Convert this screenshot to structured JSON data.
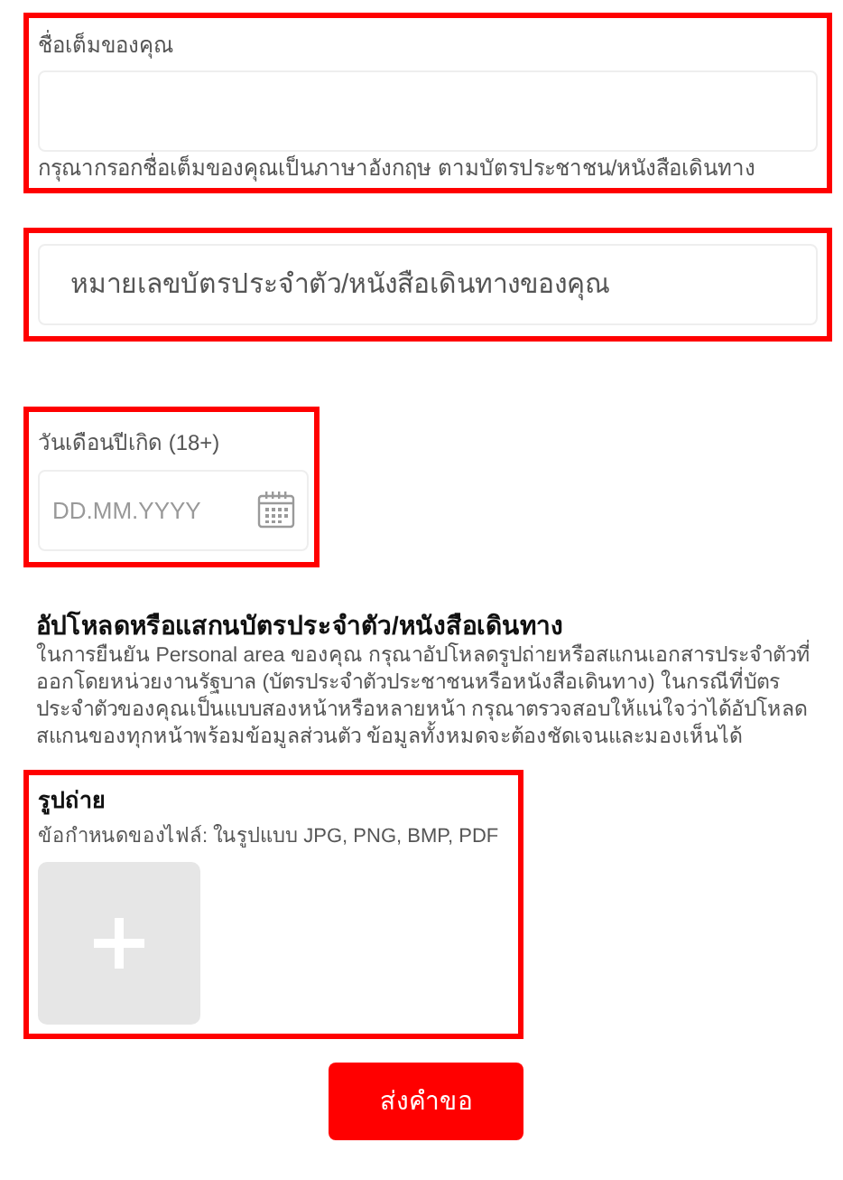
{
  "fields": [
    {
      "kind": "text",
      "label": "ชื่อเต็มของคุณ",
      "hint": "กรุณากรอกชื่อเต็มของคุณเป็นภาษาอังกฤษ ตามบัตรประชาชน/หนังสือเดินทาง"
    },
    {
      "kind": "text",
      "placeholder": "หมายเลขบัตรประจำตัว/หนังสือเดินทางของคุณ"
    },
    {
      "kind": "date",
      "label": "วันเดือนปีเกิด (18+)",
      "placeholder": "DD.MM.YYYY"
    }
  ],
  "upload_section": {
    "title": "อัปโหลดหรือแสกนบัตรประจำตัว/หนังสือเดินทาง",
    "description": "ในการยืนยัน Personal area ของคุณ กรุณาอัปโหลดรูปถ่ายหรือสแกนเอกสารประจำตัวที่ออกโดยหน่วยงานรัฐบาล (บัตรประจำตัวประชาชนหรือหนังสือเดินทาง) ในกรณีที่บัตรประจำตัวของคุณเป็นแบบสองหน้าหรือหลายหน้า กรุณาตรวจสอบให้แน่ใจว่าได้อัปโหลดสแกนของทุกหน้าพร้อมข้อมูลส่วนตัว ข้อมูลทั้งหมดจะต้องชัดเจนและมองเห็นได้"
  },
  "photo": {
    "label": "รูปถ่าย",
    "requirements": "ข้อกำหนดของไฟล์: ในรูปแบบ JPG, PNG, BMP, PDF"
  },
  "submit_button": "ส่งคำขอ"
}
